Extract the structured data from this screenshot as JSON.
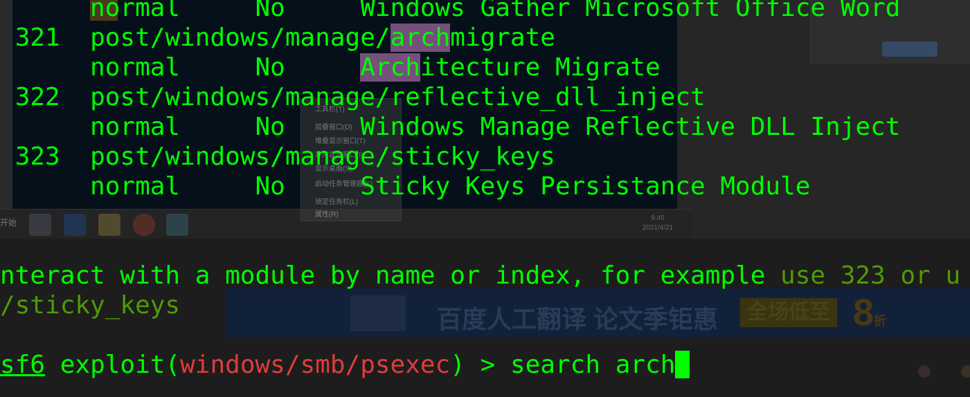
{
  "background": {
    "taskbar": {
      "start_label": "开始",
      "clock_time": "9:46",
      "clock_date": "2021/4/21"
    },
    "context_menu": {
      "items": [
        "工具栏(T)",
        "层叠窗口(D)",
        "堆叠显示窗口(T)",
        "并排显示窗口(I)",
        "显示桌面(S)",
        "启动任务管理器(K)",
        "锁定任务栏(L)",
        "属性(R)"
      ]
    },
    "ad_banner": {
      "text": "百度人工翻译 论文季钜惠",
      "tag": "全场低至",
      "number": "8",
      "suffix": "折"
    }
  },
  "terminal": {
    "colors": {
      "fg": "#00ff00",
      "dim": "#4e9a06",
      "red": "#e03c3c",
      "highlight": "#75507b",
      "bg": "#1d1d1d"
    },
    "rows": [
      {
        "index": "",
        "path_pre": "",
        "path_hl": "",
        "path_post": "",
        "rank": "normal",
        "check": "No",
        "desc_hl": "",
        "desc_post": "Windows Gather Microsoft Office Word"
      },
      {
        "index": "321",
        "path_pre": "post/windows/manage/",
        "path_hl": "arch",
        "path_post": "migrate",
        "rank": "normal",
        "check": "No",
        "desc_hl": "Arch",
        "desc_post": "itecture Migrate"
      },
      {
        "index": "322",
        "path_pre": "post/windows/manage/reflective_dll_inject",
        "path_hl": "",
        "path_post": "",
        "rank": "normal",
        "check": "No",
        "desc_hl": "",
        "desc_post": "Windows Manage Reflective DLL Inject"
      },
      {
        "index": "323",
        "path_pre": "post/windows/manage/sticky_keys",
        "path_hl": "",
        "path_post": "",
        "rank": "normal",
        "check": "No",
        "desc_hl": "",
        "desc_post": "Sticky Keys Persistance Module"
      }
    ],
    "hint": {
      "text": "nteract with a module by name or index, for example ",
      "example": "use 323 or u",
      "continuation": "/sticky_keys"
    },
    "prompt": {
      "name": "sf6",
      "word": "exploit",
      "open": "(",
      "module": "windows/smb/psexec",
      "close": ")",
      "arrow": " > ",
      "command": "search arch"
    }
  }
}
